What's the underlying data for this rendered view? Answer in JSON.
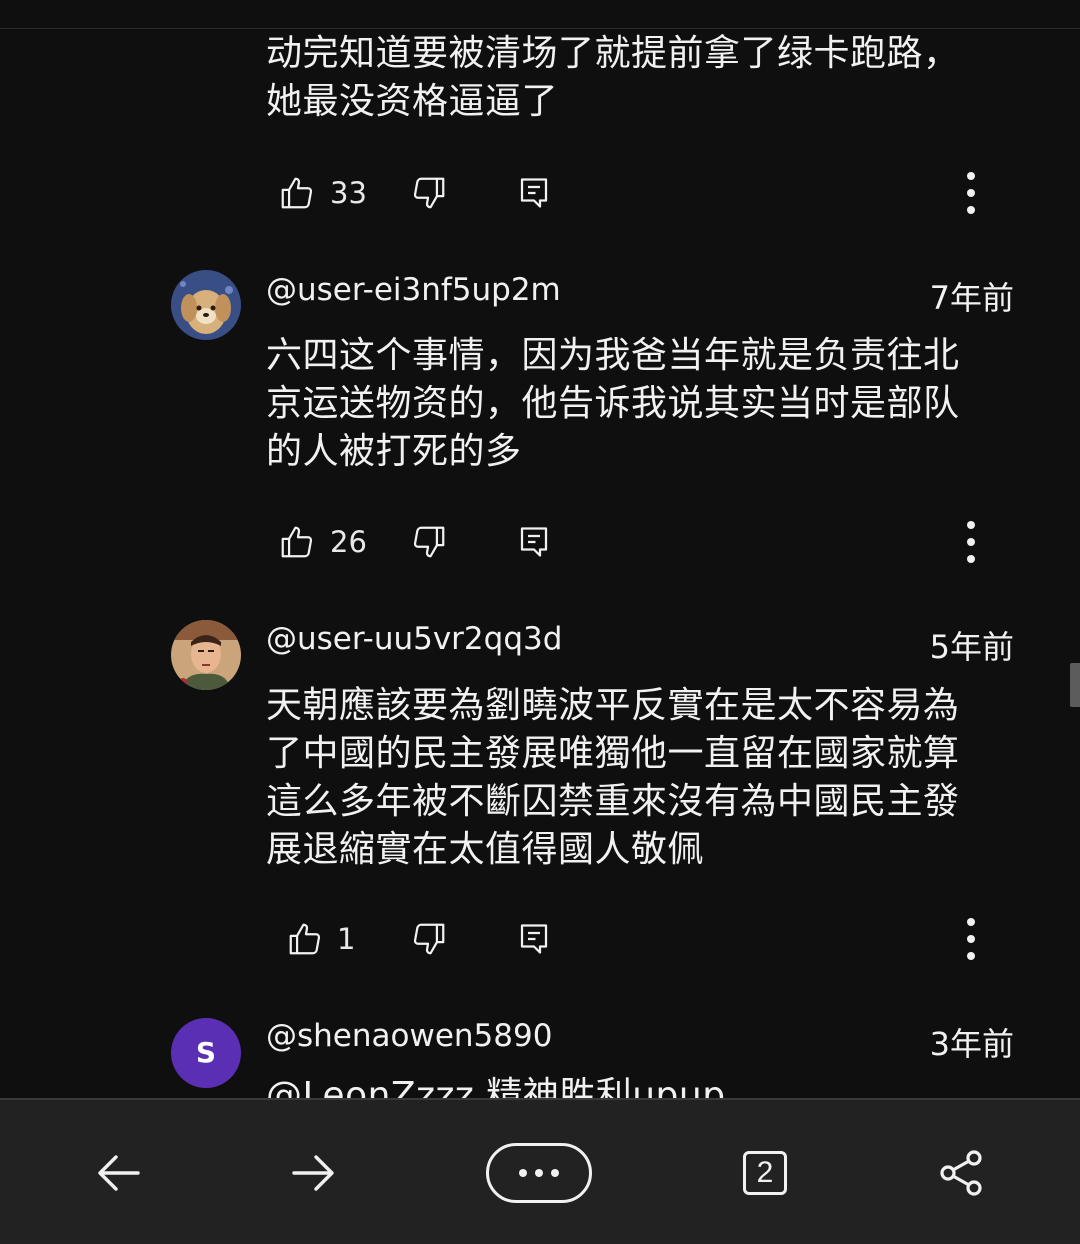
{
  "comments": [
    {
      "text": "动完知道要被清场了就提前拿了绿卡跑路，\n她最没资格逼逼了",
      "likes": "33"
    },
    {
      "handle": "@user-ei3nf5up2m",
      "time": "7年前",
      "text": "六四这个事情，因为我爸当年就是负责往北\n京运送物资的，他告诉我说其实当时是部队\n的人被打死的多",
      "likes": "26"
    },
    {
      "handle": "@user-uu5vr2qq3d",
      "time": "5年前",
      "text": "天朝應該要為劉曉波平反實在是太不容易為\n了中國的民主發展唯獨他一直留在國家就算\n這么多年被不斷囚禁重來沒有為中國民主發\n展退縮實在太值得國人敬佩",
      "likes": "1"
    },
    {
      "handle": "@shenaowen5890",
      "time": "3年前",
      "avatar_letter": "S",
      "text": "@LeonZzzz 精神胜利upup"
    }
  ],
  "bottom_nav": {
    "tab_count": "2",
    "icons": [
      "back-arrow-icon",
      "forward-arrow-icon",
      "more-icon",
      "tabs-icon",
      "share-icon"
    ]
  },
  "colors": {
    "background": "#0f0f0f",
    "bottom_bar": "#222222",
    "text": "#f1f1f1",
    "avatar_s": "#5b2fb4"
  }
}
